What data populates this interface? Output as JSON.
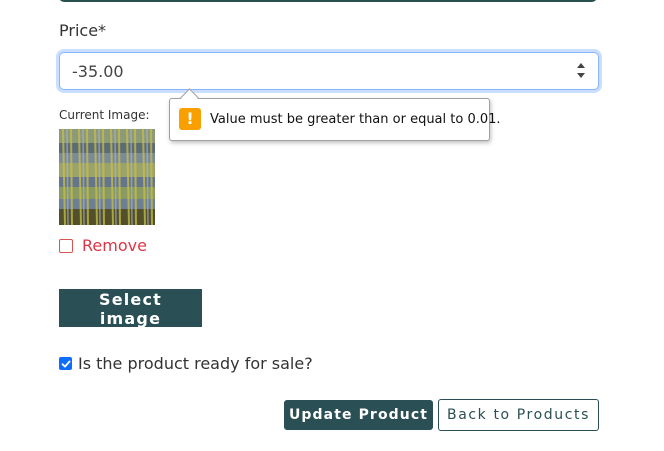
{
  "form": {
    "price_label": "Price*",
    "price_value": "-35.00",
    "current_image_label": "Current Image:",
    "remove_label": "Remove",
    "select_image_label": "Select image",
    "ready_for_sale_label": "Is the product ready for sale?",
    "ready_for_sale_checked": true,
    "remove_checked": false
  },
  "validation": {
    "message": "Value must be greater than or equal to 0.01.",
    "icon": "warning-icon"
  },
  "actions": {
    "update_label": "Update Product",
    "back_label": "Back to Products"
  },
  "colors": {
    "primary": "#2a4f54",
    "danger": "#dc3545",
    "warning": "#f9a000",
    "focus": "#86b7fe",
    "checkbox": "#0d6efd"
  }
}
